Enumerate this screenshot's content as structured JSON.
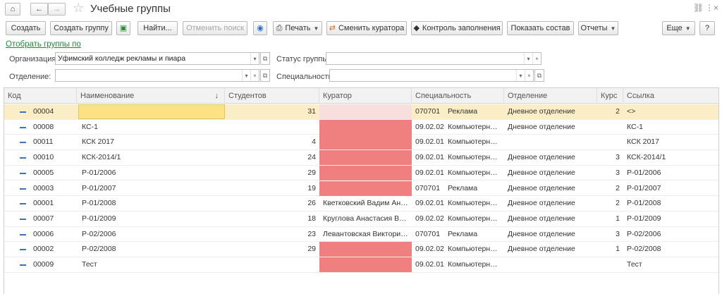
{
  "window": {
    "title": "Учебные группы",
    "home_icon": "home-icon",
    "back_icon": "back-arrow-icon",
    "forward_icon": "forward-arrow-icon",
    "star": "☆",
    "link_icon": "🔗",
    "more": "⋮",
    "close": "×"
  },
  "toolbar": {
    "create": "Создать",
    "create_group": "Создать группу",
    "find": "Найти...",
    "cancel_search": "Отменить поиск",
    "print": "Печать",
    "change_curator": "Сменить куратора",
    "fill_control": "Контроль заполнения",
    "show_members": "Показать состав",
    "reports": "Отчеты",
    "more": "Еще",
    "help": "?"
  },
  "filters": {
    "link": "Отобрать группы по",
    "org_label": "Организация:",
    "org_value": "Уфимский колледж рекламы и пиара",
    "status_label": "Статус группы:",
    "status_value": "",
    "dept_label": "Отделение:",
    "dept_value": "",
    "spec_label": "Специальность:",
    "spec_value": ""
  },
  "table": {
    "columns": [
      "Код",
      "Наименование",
      "Студентов",
      "Куратор",
      "Специальность",
      "Отделение",
      "Курс",
      "Ссылка"
    ],
    "sort_arrow": "↓",
    "rows": [
      {
        "code": "00004",
        "name": "",
        "students": "31",
        "curator": "",
        "curator_state": "pink",
        "spec_code": "070701",
        "spec_name": "Реклама",
        "dept": "Дневное отделение",
        "course": "2",
        "link": "<>",
        "selected": true
      },
      {
        "code": "00008",
        "name": "КС-1",
        "students": "",
        "curator": "",
        "curator_state": "red",
        "spec_code": "09.02.02",
        "spec_name": "Компьютерны...",
        "dept": "Дневное отделение",
        "course": "",
        "link": "КС-1",
        "selected": false
      },
      {
        "code": "00011",
        "name": "КСК 2017",
        "students": "4",
        "curator": "",
        "curator_state": "red",
        "spec_code": "09.02.01",
        "spec_name": "Компьютерны...",
        "dept": "",
        "course": "",
        "link": "КСК 2017",
        "selected": false
      },
      {
        "code": "00010",
        "name": "КСК-2014/1",
        "students": "24",
        "curator": "",
        "curator_state": "red",
        "spec_code": "09.02.01",
        "spec_name": "Компьютерны...",
        "dept": "Дневное отделение",
        "course": "3",
        "link": "КСК-2014/1",
        "selected": false
      },
      {
        "code": "00005",
        "name": "Р-01/2006",
        "students": "29",
        "curator": "",
        "curator_state": "red",
        "spec_code": "09.02.01",
        "spec_name": "Компьютерны...",
        "dept": "Дневное отделение",
        "course": "3",
        "link": "Р-01/2006",
        "selected": false
      },
      {
        "code": "00003",
        "name": "Р-01/2007",
        "students": "19",
        "curator": "",
        "curator_state": "red",
        "spec_code": "070701",
        "spec_name": "Реклама",
        "dept": "Дневное отделение",
        "course": "2",
        "link": "Р-01/2007",
        "selected": false
      },
      {
        "code": "00001",
        "name": "Р-01/2008",
        "students": "26",
        "curator": "Кветковский Вадим Ант...",
        "curator_state": "ok",
        "spec_code": "09.02.01",
        "spec_name": "Компьютерны...",
        "dept": "Дневное отделение",
        "course": "2",
        "link": "Р-01/2008",
        "selected": false
      },
      {
        "code": "00007",
        "name": "Р-01/2009",
        "students": "18",
        "curator": "Круглова Анастасия Ва...",
        "curator_state": "ok",
        "spec_code": "09.02.02",
        "spec_name": "Компьютерны...",
        "dept": "Дневное отделение",
        "course": "1",
        "link": "Р-01/2009",
        "selected": false
      },
      {
        "code": "00006",
        "name": "Р-02/2006",
        "students": "23",
        "curator": "Левантовская Виктория ...",
        "curator_state": "ok",
        "spec_code": "070701",
        "spec_name": "Реклама",
        "dept": "Дневное отделение",
        "course": "3",
        "link": "Р-02/2006",
        "selected": false
      },
      {
        "code": "00002",
        "name": "Р-02/2008",
        "students": "29",
        "curator": "",
        "curator_state": "red",
        "spec_code": "09.02.02",
        "spec_name": "Компьютерны...",
        "dept": "Дневное отделение",
        "course": "1",
        "link": "Р-02/2008",
        "selected": false
      },
      {
        "code": "00009",
        "name": "Тест",
        "students": "",
        "curator": "",
        "curator_state": "red",
        "spec_code": "09.02.01",
        "spec_name": "Компьютерны...",
        "dept": "",
        "course": "",
        "link": "Тест",
        "selected": false
      }
    ]
  },
  "colors": {
    "missing_curator": "#f08080",
    "selected_row": "#fbeec6",
    "filter_link": "#1f8a3a"
  }
}
